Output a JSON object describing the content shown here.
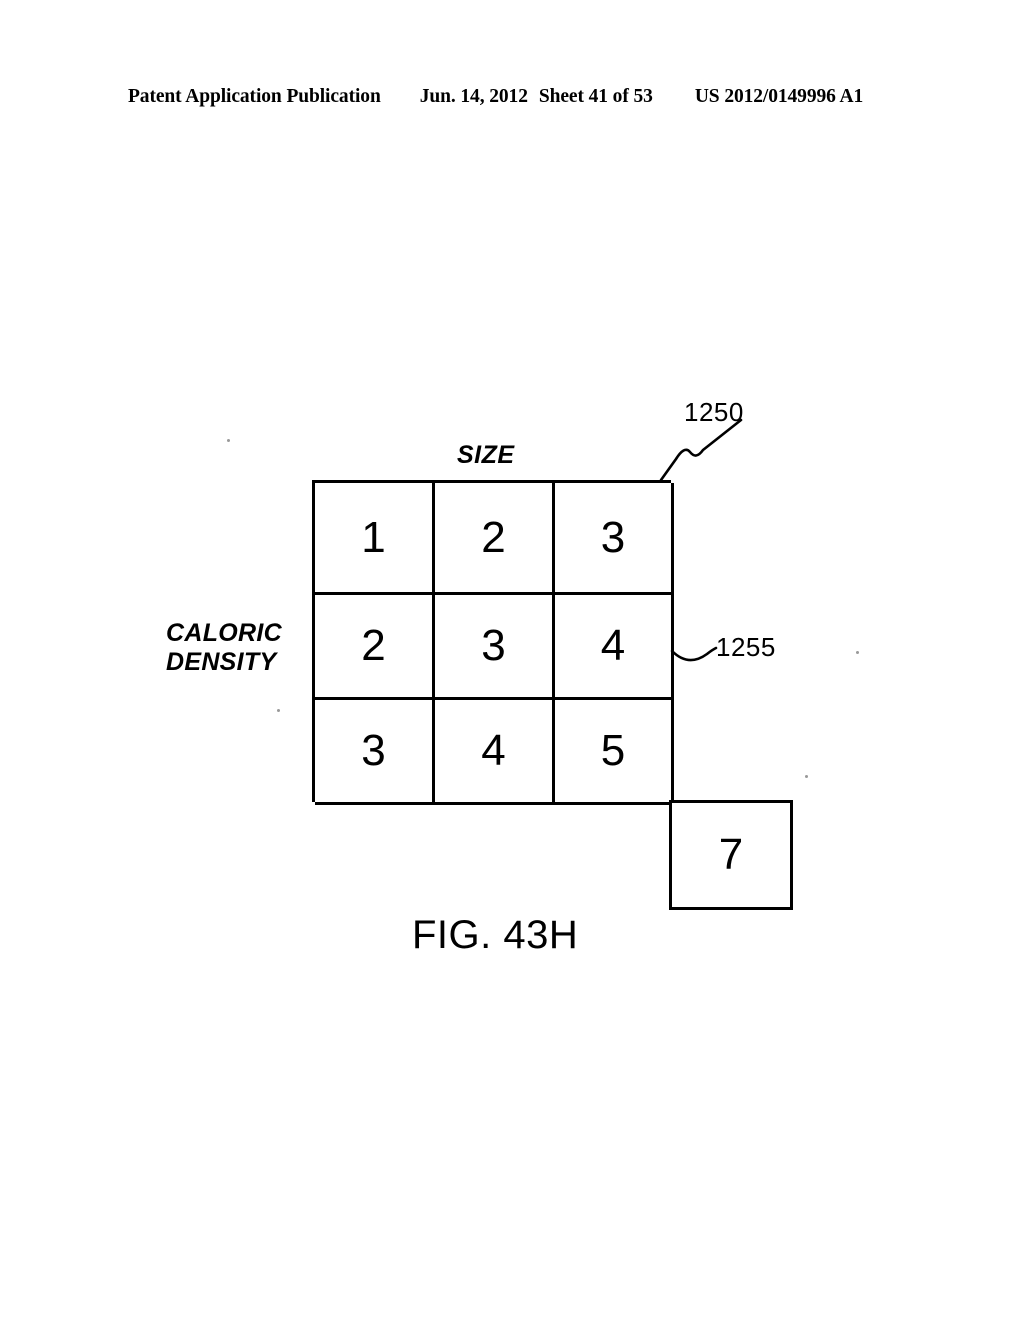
{
  "header": {
    "publication": "Patent Application Publication",
    "date": "Jun. 14, 2012",
    "sheet": "Sheet 41 of 53",
    "publication_number": "US 2012/0149996 A1"
  },
  "figure": {
    "caption": "FIG. 43H",
    "x_axis_label": "SIZE",
    "y_axis_label_line1": "CALORIC",
    "y_axis_label_line2": "DENSITY",
    "reference_numerals": [
      {
        "id": "1250",
        "label": "1250"
      },
      {
        "id": "1255",
        "label": "1255"
      }
    ],
    "extra_box_value": "7"
  },
  "chart_data": {
    "type": "table",
    "title": "FIG. 43H",
    "xlabel": "SIZE",
    "ylabel": "CALORIC DENSITY",
    "rows": [
      [
        "1",
        "2",
        "3"
      ],
      [
        "2",
        "3",
        "4"
      ],
      [
        "3",
        "4",
        "5"
      ]
    ],
    "cells": {
      "r0c0": "1",
      "r0c1": "2",
      "r0c2": "3",
      "r1c0": "2",
      "r1c1": "3",
      "r1c2": "4",
      "r2c0": "3",
      "r2c1": "4",
      "r2c2": "5"
    },
    "detached_cell": "7",
    "annotations": [
      "1250",
      "1255"
    ],
    "grid": true,
    "legend": "none"
  }
}
